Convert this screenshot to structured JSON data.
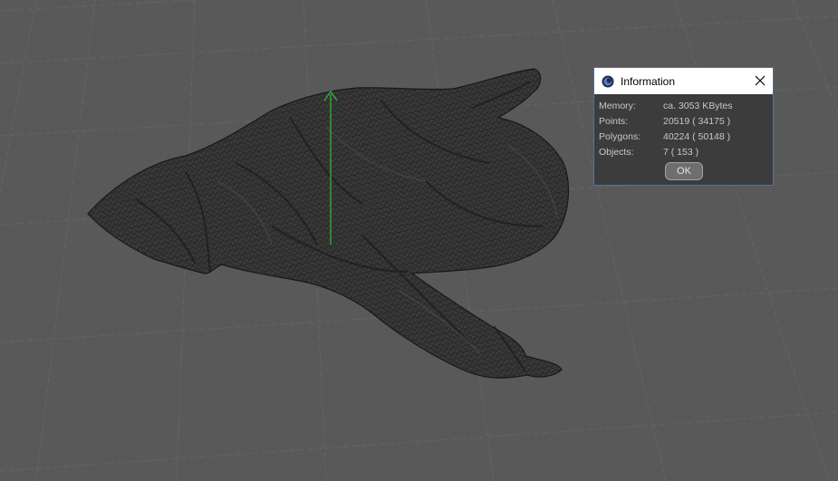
{
  "dialog": {
    "title": "Information",
    "icon": "cinema4d-logo-icon",
    "rows": [
      {
        "label": "Memory:",
        "value": "ca. 3053 KBytes"
      },
      {
        "label": "Points:",
        "value": "20519 ( 34175 )"
      },
      {
        "label": "Polygons:",
        "value": "40224 ( 50148 )"
      },
      {
        "label": "Objects:",
        "value": "7 ( 153 )"
      }
    ],
    "ok_label": "OK"
  },
  "viewport": {
    "object": "cloth-mesh",
    "axis_color": "#3cba3c",
    "mesh_color": "#3a3a3a",
    "wire_color": "#1a1a1a"
  },
  "colors": {
    "background": "#595959",
    "grid": "#666666",
    "dialog_border": "#2f7ec8"
  }
}
